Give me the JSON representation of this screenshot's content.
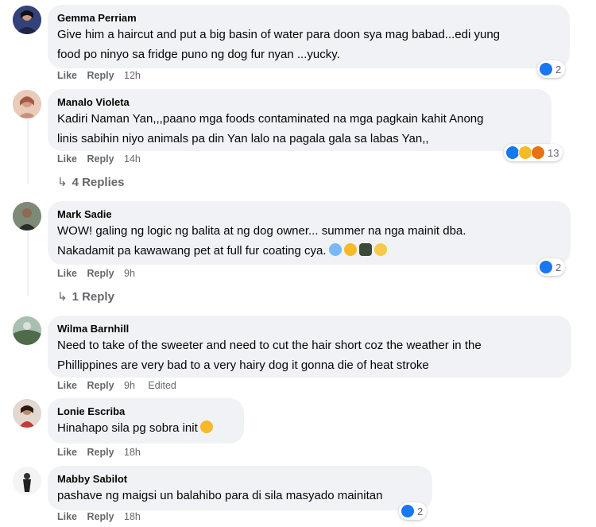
{
  "actions": {
    "like": "Like",
    "reply": "Reply",
    "edited": "Edited"
  },
  "comments": [
    {
      "author": "Gemma Perriam",
      "lines": [
        "Give him a haircut and put a big basin of water para doon sya mag babad...edi yung",
        "food po ninyo sa fridge puno ng dog fur nyan ...yucky."
      ],
      "time": "12h",
      "reaction_count": "2"
    },
    {
      "author": "Manalo Violeta",
      "lines": [
        "Kadiri Naman Yan,,,paano mga foods contaminated na mga pagkain kahit Anong",
        "linis sabihin niyo animals pa din Yan lalo na pagala gala sa labas Yan,,"
      ],
      "time": "14h",
      "reaction_count": "13",
      "replies": "4 Replies"
    },
    {
      "author": "Mark Sadie",
      "lines": [
        "WOW! galing ng logic ng balita at ng dog owner... summer na nga mainit dba.",
        "Nakadamit pa kawawang pet at full fur coating cya."
      ],
      "time": "9h",
      "reaction_count": "2",
      "replies": "1 Reply"
    },
    {
      "author": "Wilma Barnhill",
      "lines": [
        "Need to take of the sweeter and need to cut the hair short coz the weather in the",
        "Phillippines are very bad to a very hairy dog it gonna die of heat stroke"
      ],
      "time": "9h"
    },
    {
      "author": "Lonie Escriba",
      "lines": [
        "Hinahapo sila pg sobra init"
      ],
      "time": "18h"
    },
    {
      "author": "Mabby Sabilot",
      "lines": [
        "pashave ng maigsi un balahibo para di sila masyado mainitan"
      ],
      "time": "18h",
      "reaction_count": "2"
    }
  ],
  "colors": {
    "like_blue": "#1877f2",
    "bubble_bg": "#f0f2f5",
    "muted": "#65676b"
  }
}
